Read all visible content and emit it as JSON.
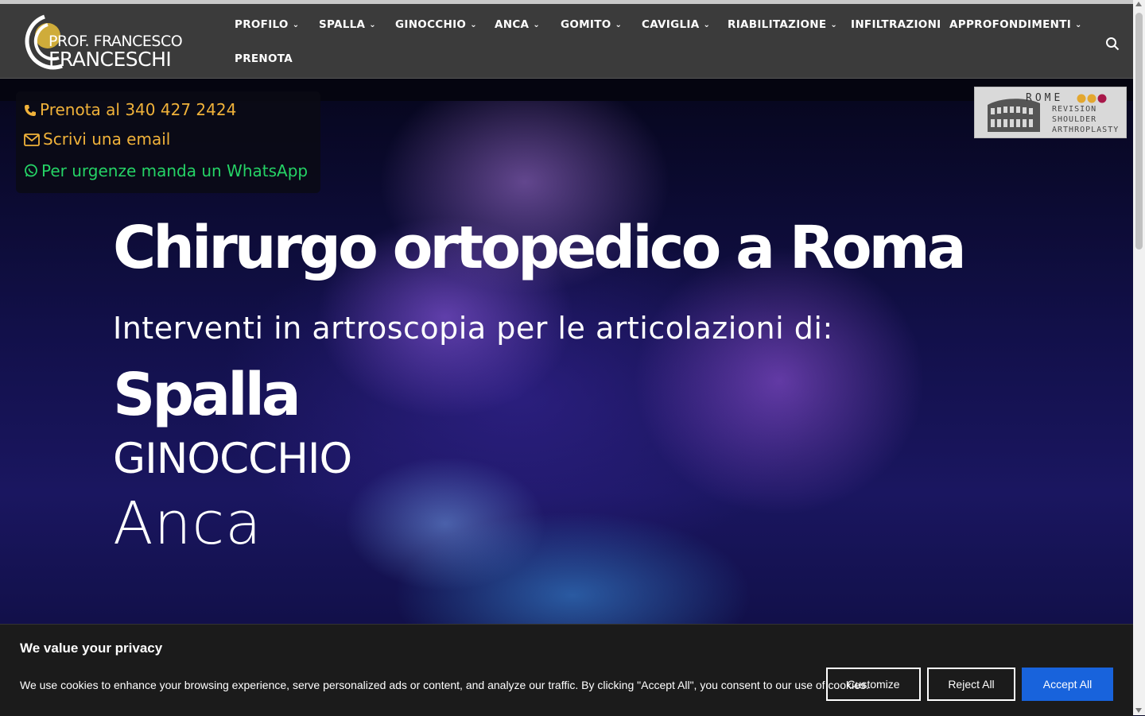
{
  "logo": {
    "line1": "PROF. FRANCESCO",
    "line2": "FRANCESCHI"
  },
  "nav": {
    "items": [
      {
        "label": "PROFILO",
        "dropdown": true
      },
      {
        "label": "SPALLA",
        "dropdown": true
      },
      {
        "label": "GINOCCHIO",
        "dropdown": true
      },
      {
        "label": "ANCA",
        "dropdown": true
      },
      {
        "label": "GOMITO",
        "dropdown": true
      },
      {
        "label": "CAVIGLIA",
        "dropdown": true
      },
      {
        "label": "RIABILITAZIONE",
        "dropdown": true
      },
      {
        "label": "INFILTRAZIONI",
        "dropdown": false
      },
      {
        "label": "APPROFONDIMENTI",
        "dropdown": true
      },
      {
        "label": "PRENOTA",
        "dropdown": false
      }
    ],
    "search_icon": "search-icon"
  },
  "contact": {
    "phone": "Prenota al 340 427 2424",
    "email": "Scrivi una email",
    "whatsapp": "Per urgenze manda un WhatsApp",
    "phone_color": "#f0b23a",
    "whatsapp_color": "#25d366"
  },
  "badge": {
    "word": "ROME",
    "line1": "REVISION",
    "line2": "SHOULDER",
    "line3": "ARTHROPLASTY"
  },
  "hero": {
    "title": "Chirurgo ortopedico a Roma",
    "subtitle": "Interventi in artroscopia per le articolazioni di:",
    "joint1": "Spalla",
    "joint2": "GINOCCHIO",
    "joint3": "Anca"
  },
  "cookie": {
    "title": "We value your privacy",
    "text": "We use cookies to enhance your browsing experience, serve personalized ads or content, and analyze our traffic. By clicking \"Accept All\", you consent to our use of cookies.",
    "customize": "Customize",
    "reject": "Reject All",
    "accept": "Accept All",
    "accent": "#1863dc"
  }
}
